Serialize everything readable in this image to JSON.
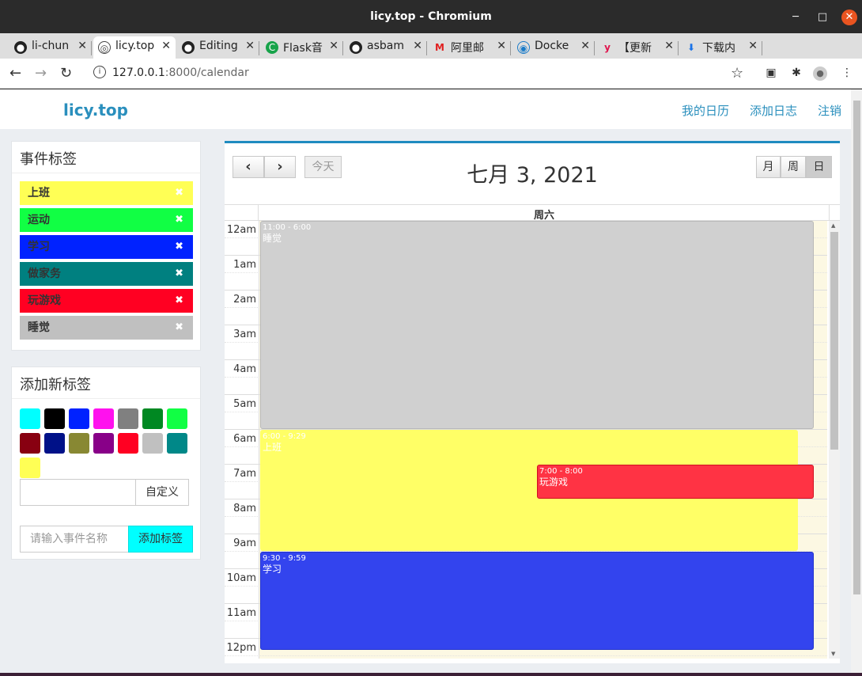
{
  "window": {
    "title": "licy.top - Chromium",
    "minimize": "─",
    "maximize": "□",
    "close": "✕"
  },
  "tabs": [
    {
      "label": "li-chun",
      "icon": "github-icon"
    },
    {
      "label": "licy.top",
      "icon": "globe-icon"
    },
    {
      "label": "Editing",
      "icon": "github-icon"
    },
    {
      "label": "Flask音",
      "icon": "c-icon"
    },
    {
      "label": "asbam",
      "icon": "github-icon"
    },
    {
      "label": "阿里邮",
      "icon": "mail-icon"
    },
    {
      "label": "Docke",
      "icon": "docker-icon"
    },
    {
      "label": "【更新",
      "icon": "y-icon"
    },
    {
      "label": "下载内",
      "icon": "download-icon"
    }
  ],
  "tab_close": "✕",
  "new_tab": "+",
  "address": {
    "host": "127.0.0.1",
    "rest": ":8000/calendar"
  },
  "site": {
    "brand": "licy.top",
    "nav": [
      "我的日历",
      "添加日志",
      "注销"
    ]
  },
  "sidebar": {
    "tags_title": "事件标签",
    "tags": [
      {
        "label": "上班",
        "color": "#ffff55"
      },
      {
        "label": "运动",
        "color": "#11ff44"
      },
      {
        "label": "学习",
        "color": "#0022ff"
      },
      {
        "label": "做家务",
        "color": "#008080"
      },
      {
        "label": "玩游戏",
        "color": "#ff0022"
      },
      {
        "label": "睡觉",
        "color": "#c0c0c0"
      }
    ],
    "remove_symbol": "✖",
    "add_title": "添加新标签",
    "swatches": [
      "#00ffff",
      "#000000",
      "#0022ff",
      "#ff11ee",
      "#808080",
      "#008822",
      "#11ff44",
      "#880011",
      "#001188",
      "#888833",
      "#880088",
      "#ff0022",
      "#c0c0c0",
      "#008888",
      "#ffff55"
    ],
    "custom_button": "自定义",
    "event_placeholder": "请输入事件名称",
    "add_button": "添加标签",
    "add_button_color": "#00ffff"
  },
  "calendar": {
    "prev": "‹",
    "next": "›",
    "today": "今天",
    "title": "七月 3, 2021",
    "views": [
      "月",
      "周",
      "日"
    ],
    "active_view": "日",
    "day_header": "周六",
    "hours": [
      "12am",
      "1am",
      "2am",
      "3am",
      "4am",
      "5am",
      "6am",
      "7am",
      "8am",
      "9am",
      "10am",
      "11am",
      "12pm"
    ],
    "events": [
      {
        "time": "11:00 - 6:00",
        "title": "睡觉",
        "color": "#d0d0d0",
        "text_color": "#ffffff",
        "start": 0,
        "end": 6,
        "col": "full"
      },
      {
        "time": "6:00 - 9:29",
        "title": "上班",
        "color": "#ffff66",
        "text_color": "#ffffff",
        "start": 6,
        "end": 9.5,
        "col": "left-wide"
      },
      {
        "time": "7:00 - 8:00",
        "title": "玩游戏",
        "color": "#ff3344",
        "text_color": "#ffffff",
        "start": 7,
        "end": 8,
        "col": "right"
      },
      {
        "time": "9:30 - 9:59",
        "title": "学习",
        "color": "#3344ee",
        "text_color": "#ffffff",
        "start": 9.5,
        "end": 12.35,
        "col": "full"
      }
    ]
  }
}
